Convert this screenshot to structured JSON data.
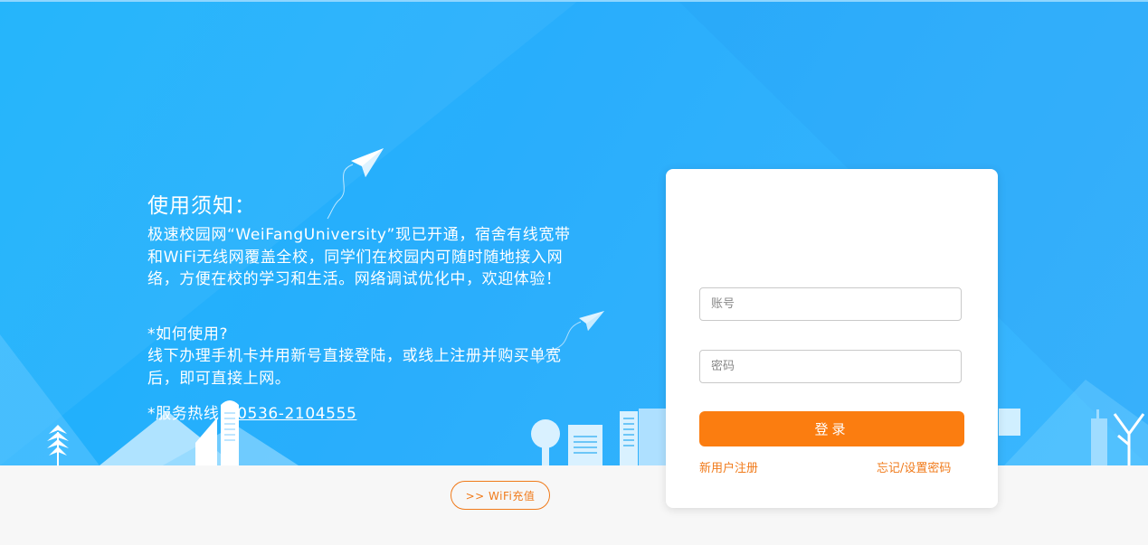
{
  "notice": {
    "title": "使用须知：",
    "body": "极速校园网“WeiFangUniversity”现已开通，宿舍有线宽带和WiFi无线网覆盖全校，同学们在校园内可随时随地接入网络，方便在校的学习和生活。网络调试优化中，欢迎体验！",
    "howto_title": "*如何使用?",
    "howto_body": "线下办理手机卡并用新号直接登陆，或线上注册并购买单宽后，即可直接上网。",
    "hotline_label": "*服务热线：",
    "hotline_number": "0536-2104555"
  },
  "login": {
    "account_placeholder": "账号",
    "password_placeholder": "密码",
    "login_label": "登录",
    "register_link": "新用户注册",
    "forgot_link": "忘记/设置密码"
  },
  "wifi_recharge_label": ">> WiFi充值",
  "colors": {
    "hero_blue": "#1ab2fb",
    "accent_orange": "#fb7d10",
    "page_background": "#f7f7f7"
  },
  "icons": [
    "paper-plane-icon",
    "city-skyline-illustration"
  ]
}
